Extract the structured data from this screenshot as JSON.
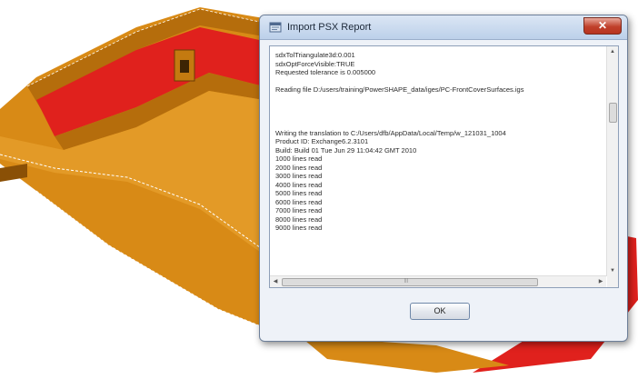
{
  "background": {
    "part_color": "#d88a16",
    "part_dark": "#9c5a08",
    "highlight_color": "#e0211d"
  },
  "dialog": {
    "title": "Import PSX Report",
    "title_icon": "report-window-icon",
    "close_icon": "close-icon",
    "close_glyph": "✕",
    "report_lines": [
      "sdxTolTriangulate3d:0.001",
      "sdxOptForceVisible:TRUE",
      "Requested tolerance is 0.005000",
      "",
      "Reading file D:/users/training/PowerSHAPE_data/iges/PC-FrontCoverSurfaces.igs",
      "",
      "",
      "",
      "",
      "Writing the translation to C:/Users/dfb/AppData/Local/Temp/w_121031_1004",
      "Product ID: Exchange6.2.3101",
      "Build: Build 01 Tue Jun 29 11:04:42 GMT 2010",
      "1000 lines read",
      "2000 lines read",
      "3000 lines read",
      "4000 lines read",
      "5000 lines read",
      "6000 lines read",
      "7000 lines read",
      "8000 lines read",
      "9000 lines read"
    ],
    "scroll_up": "▲",
    "scroll_down": "▼",
    "scroll_left": "◀",
    "scroll_right": "▶",
    "grip": "|||",
    "ok_label": "OK"
  }
}
